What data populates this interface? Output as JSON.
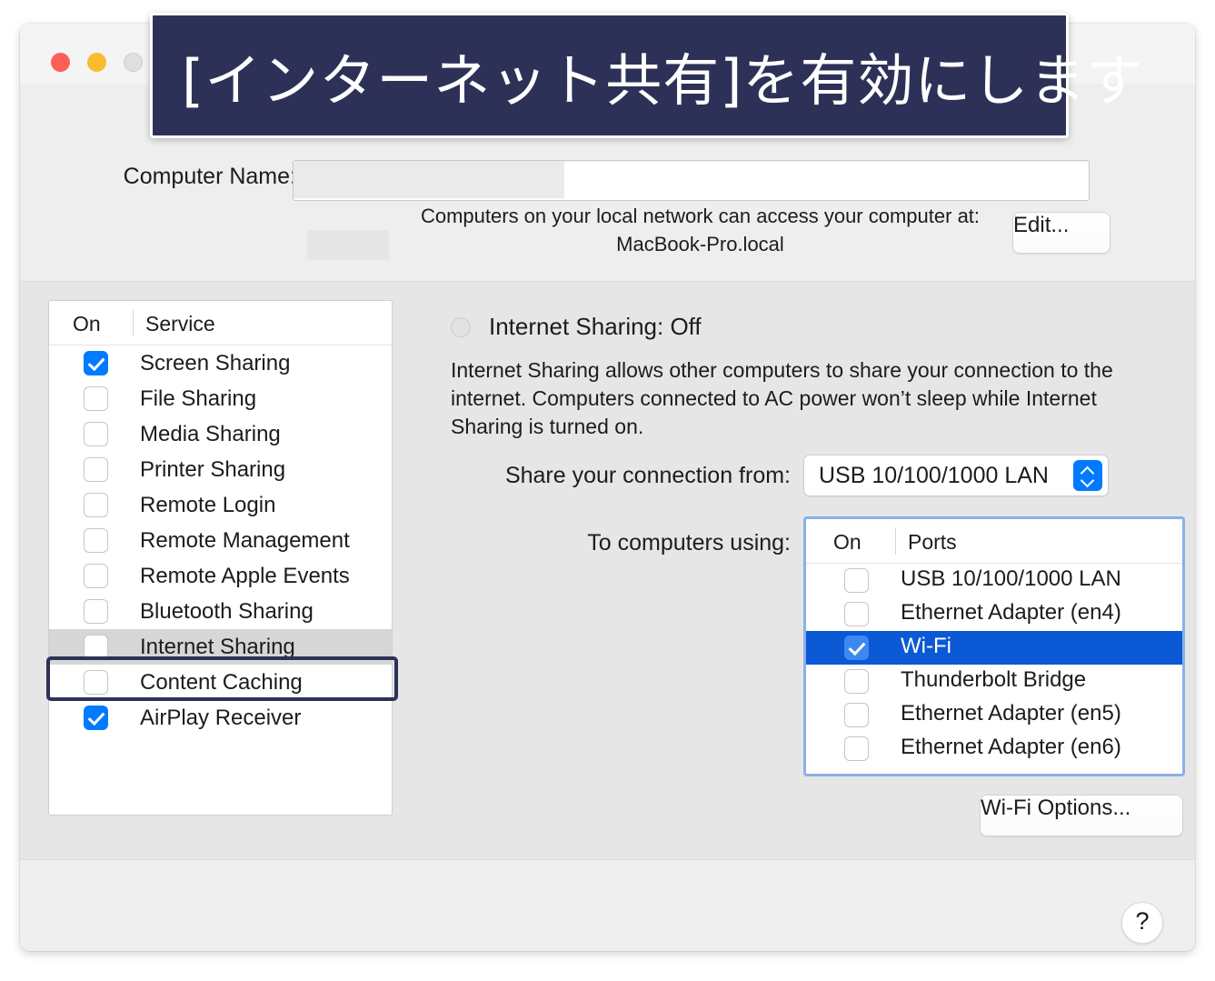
{
  "overlay": {
    "text": "[インターネット共有]を有効にします",
    "background_color": "#2e3157"
  },
  "window": {
    "traffic_lights": [
      "close",
      "minimize",
      "zoom-disabled"
    ]
  },
  "header": {
    "computer_name_label": "Computer Name:",
    "computer_name_value": "",
    "local_access_text": "Computers on your local network can access your computer at:",
    "hostname": "MacBook-Pro.local",
    "edit_button": "Edit..."
  },
  "services_table": {
    "col_on": "On",
    "col_service": "Service",
    "rows": [
      {
        "label": "Screen Sharing",
        "checked": true,
        "selected": false
      },
      {
        "label": "File Sharing",
        "checked": false,
        "selected": false
      },
      {
        "label": "Media Sharing",
        "checked": false,
        "selected": false
      },
      {
        "label": "Printer Sharing",
        "checked": false,
        "selected": false
      },
      {
        "label": "Remote Login",
        "checked": false,
        "selected": false
      },
      {
        "label": "Remote Management",
        "checked": false,
        "selected": false
      },
      {
        "label": "Remote Apple Events",
        "checked": false,
        "selected": false
      },
      {
        "label": "Bluetooth Sharing",
        "checked": false,
        "selected": false
      },
      {
        "label": "Internet Sharing",
        "checked": false,
        "selected": true
      },
      {
        "label": "Content Caching",
        "checked": false,
        "selected": false
      },
      {
        "label": "AirPlay Receiver",
        "checked": true,
        "selected": false
      }
    ]
  },
  "detail": {
    "status_title": "Internet Sharing: Off",
    "status_state": "off",
    "description": "Internet Sharing allows other computers to share your connection to the internet. Computers connected to AC power won’t sleep while Internet Sharing is turned on.",
    "share_from_label": "Share your connection from:",
    "share_from_value": "USB 10/100/1000 LAN",
    "to_computers_label": "To computers using:",
    "ports_table": {
      "col_on": "On",
      "col_ports": "Ports",
      "rows": [
        {
          "label": "USB 10/100/1000 LAN",
          "checked": false,
          "selected": false
        },
        {
          "label": "Ethernet Adapter (en4)",
          "checked": false,
          "selected": false
        },
        {
          "label": "Wi-Fi",
          "checked": true,
          "selected": true
        },
        {
          "label": "Thunderbolt Bridge",
          "checked": false,
          "selected": false
        },
        {
          "label": "Ethernet Adapter (en5)",
          "checked": false,
          "selected": false
        },
        {
          "label": "Ethernet Adapter (en6)",
          "checked": false,
          "selected": false
        }
      ]
    },
    "wifi_options_button": "Wi-Fi Options..."
  },
  "footer": {
    "help_button": "?"
  },
  "colors": {
    "accent_blue": "#007aff",
    "selection_blue": "#0b59d4",
    "annotation_navy": "#2e3157",
    "focus_ring": "#8ab0e8"
  }
}
